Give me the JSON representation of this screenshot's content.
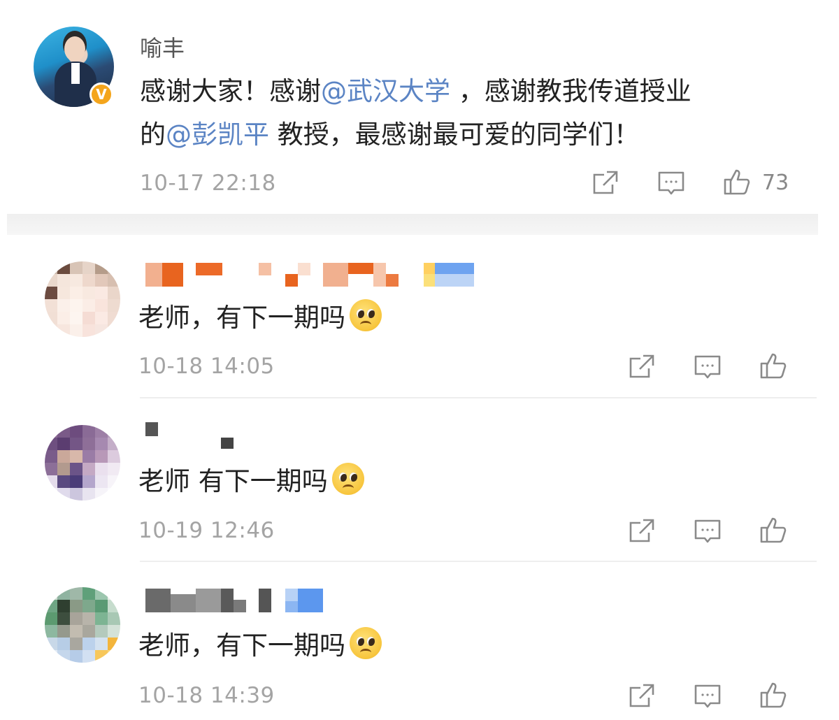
{
  "post": {
    "author": "喻丰",
    "text_parts": {
      "t1": "感谢大家！感谢",
      "m1": "@武汉大学",
      "t2": " ，感谢教我传道授业",
      "t3": "的",
      "m2": "@彭凯平",
      "t4": " 教授，最感谢最可爱的同学们！"
    },
    "timestamp": "10-17 22:18",
    "like_count": "73",
    "badge": "V"
  },
  "comments": [
    {
      "text": "老师，有下一期吗",
      "timestamp": "10-18 14:05"
    },
    {
      "text": "老师 有下一期吗",
      "timestamp": "10-19 12:46"
    },
    {
      "text": "老师，有下一期吗",
      "timestamp": "10-18 14:39"
    }
  ],
  "icons": {
    "share": "share-icon",
    "comment": "comment-icon",
    "like": "like-icon",
    "emoji": "pleading-face-emoji"
  },
  "colors": {
    "mention": "#5b84c4",
    "verified_badge": "#f4a51c",
    "timestamp": "#a4a4a4"
  }
}
